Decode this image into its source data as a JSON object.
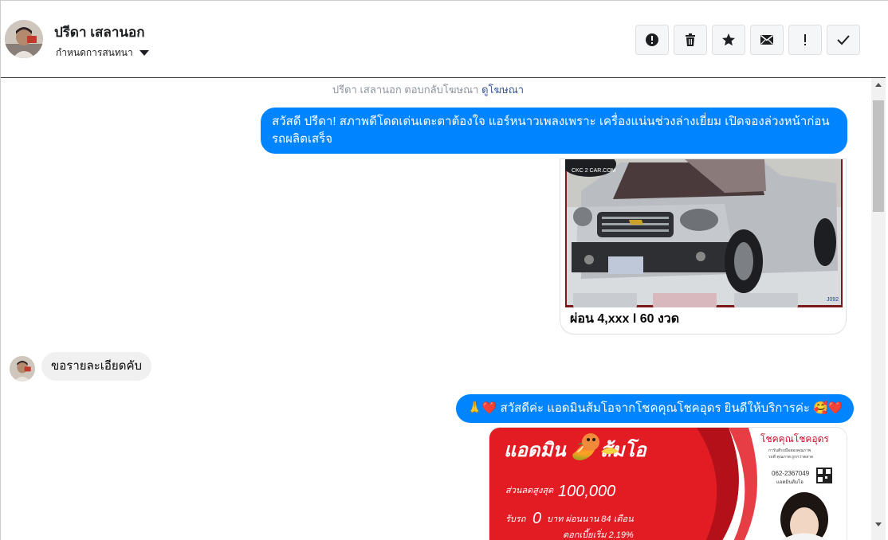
{
  "header": {
    "contact_name": "ปรีดา เสลานอก",
    "conversation_menu_label": "กำหนดการสนทนา",
    "actions": [
      {
        "name": "report-button",
        "icon": "alert-circle-icon"
      },
      {
        "name": "delete-button",
        "icon": "trash-icon"
      },
      {
        "name": "star-button",
        "icon": "star-icon"
      },
      {
        "name": "mark-unread-button",
        "icon": "envelope-icon"
      },
      {
        "name": "mark-important-button",
        "icon": "exclamation-icon"
      },
      {
        "name": "mark-done-button",
        "icon": "check-icon"
      }
    ]
  },
  "thread": {
    "ad_reply_text": "ปรีดา เสลานอก ตอบกลับโฆษณา",
    "ad_link": "ดูโฆษณา",
    "msg1": "สวัสดี ปรีดา! สภาพดีโดดเด่นเตะตาต้องใจ แอร์หนาวเพลงเพราะ เครื่องแน่นช่วงล่างเยี่ยม เปิดจองล่วงหน้าก่อนรถผลิตเสร็จ",
    "card": {
      "caption": "ผ่อน 4,xxx l 60 งวด",
      "watermark": "CKC 2 CAR.COM",
      "stock_code": "J092"
    },
    "msg2": "ขอรายละเอียดคับ",
    "msg3": "🙏❤️ สวัสดีค่ะ แอดมินส้มโอจากโชคคุณโชคอุดร ยินดีให้บริการค่ะ 🥰❤️",
    "promo": {
      "title": "แอดมิน 🥭 ส้มโอ",
      "brand": "โชคคุณโชคอุดร",
      "brand_sub": "การันตีรถมือสองคุณภาพ",
      "brand_sub2": "รถดี คุณภาพ ถูกกว่าตลาด",
      "phone": "062-2367049",
      "phone_label": "แอดมินส้มโอ",
      "discount_label": "ส่วนลดสูงสุด",
      "discount_value": "100,000",
      "down_label": "รับรถ",
      "down_value": "0",
      "down_tail": "บาท ผ่อนนาน 84 เดือน",
      "more": "ดอกเบี้ยเริ่ม 2.19%"
    }
  },
  "colors": {
    "outgoing_bubble": "#0084ff",
    "incoming_bubble": "#f0f0f0",
    "link": "#385898",
    "promo_red": "#e31b23"
  }
}
